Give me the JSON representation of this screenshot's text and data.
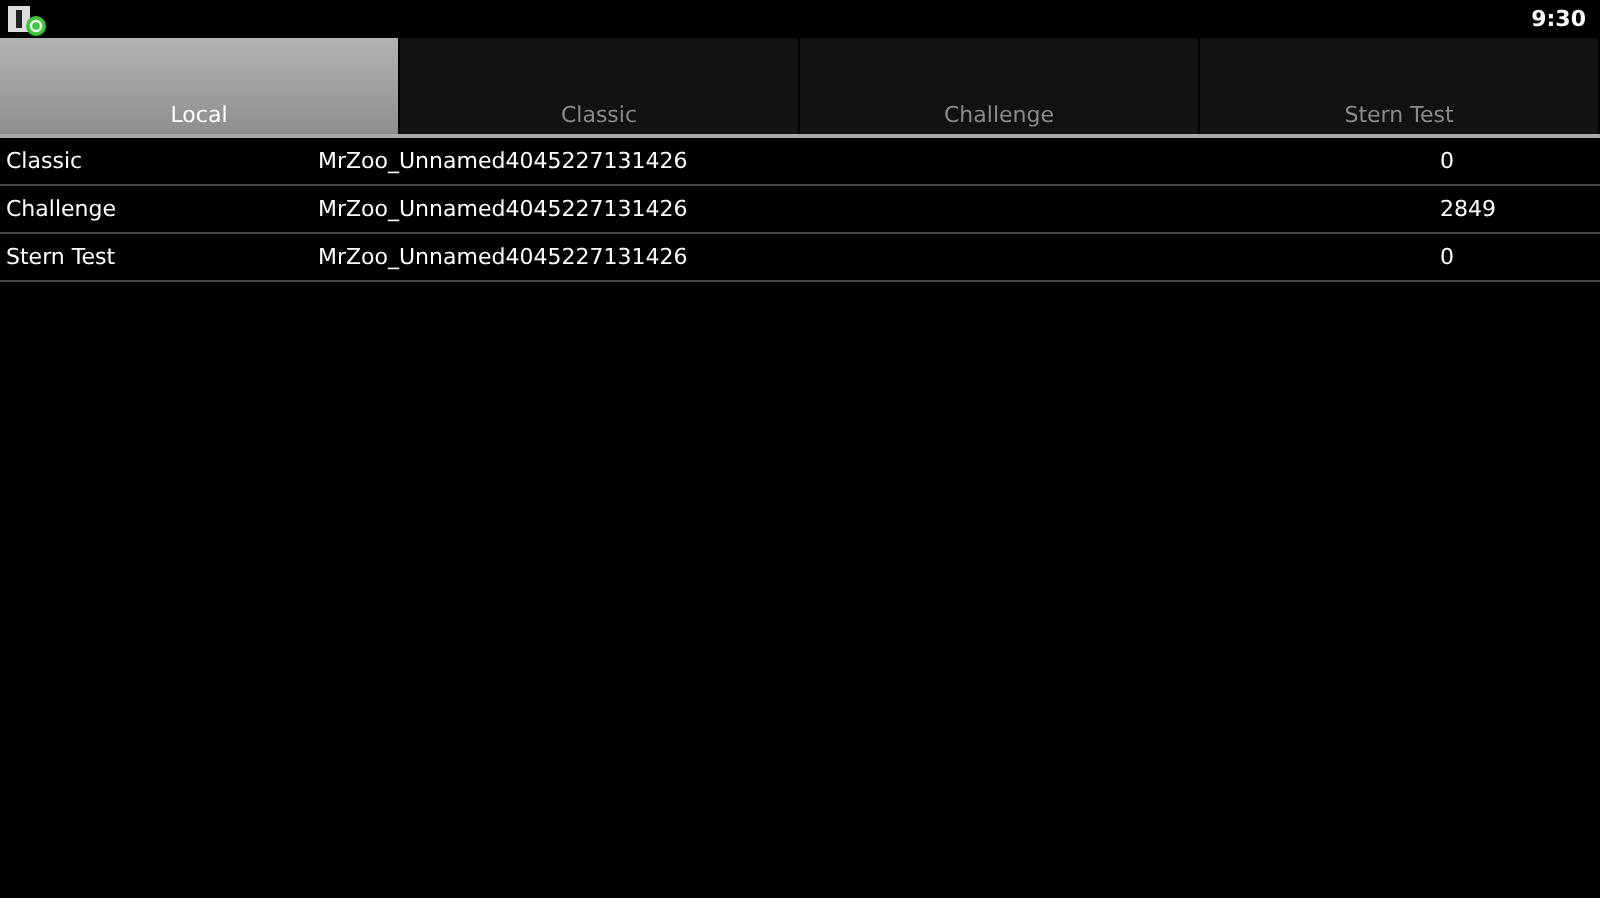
{
  "status_bar": {
    "time": "9:30"
  },
  "tabs": [
    {
      "label": "Local",
      "selected": true
    },
    {
      "label": "Classic",
      "selected": false
    },
    {
      "label": "Challenge",
      "selected": false
    },
    {
      "label": "Stern Test",
      "selected": false
    }
  ],
  "rows": [
    {
      "mode": "Classic",
      "player": "MrZoo_Unnamed4045227131426",
      "score": "0"
    },
    {
      "mode": "Challenge",
      "player": "MrZoo_Unnamed4045227131426",
      "score": "2849"
    },
    {
      "mode": "Stern Test",
      "player": "MrZoo_Unnamed4045227131426",
      "score": "0"
    }
  ]
}
